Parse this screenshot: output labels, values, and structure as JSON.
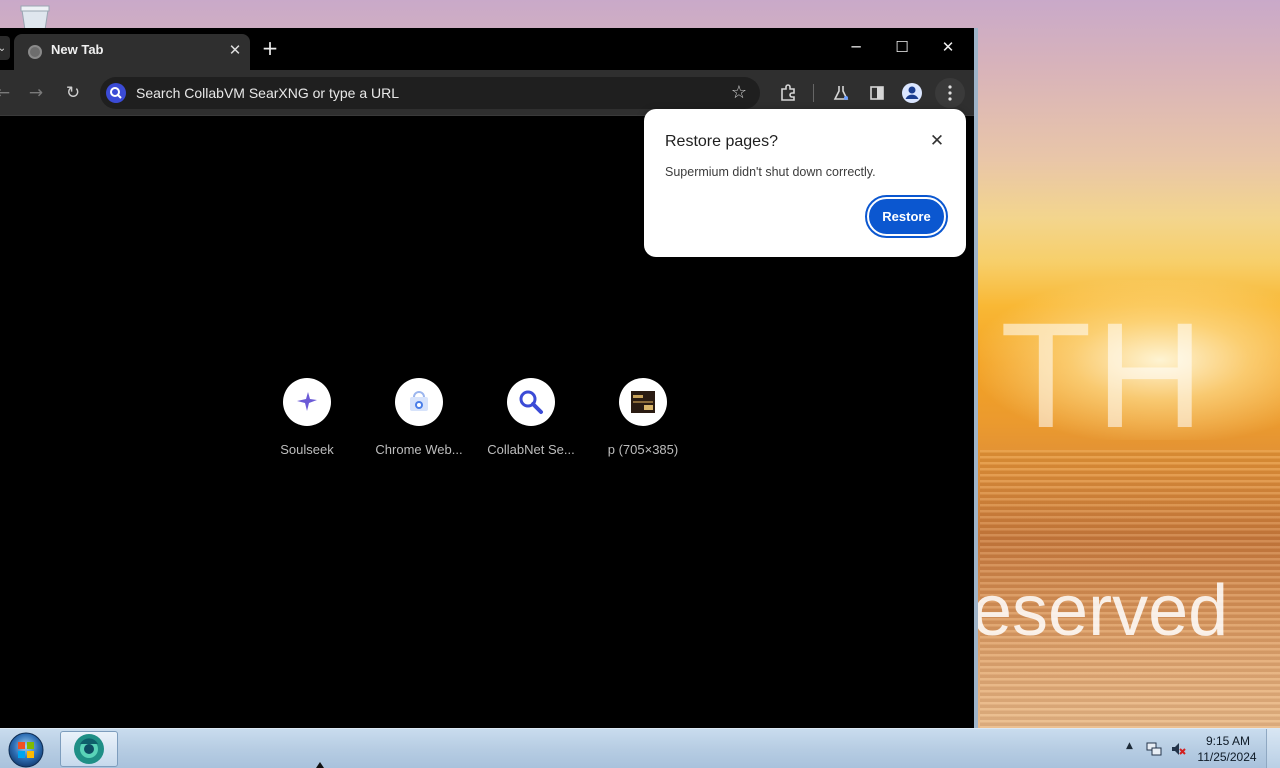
{
  "browser": {
    "tab": {
      "title": "New Tab",
      "favicon": "globe-icon"
    },
    "window_controls": {
      "minimize": "─",
      "maximize": "☐",
      "close": "✕"
    },
    "omnibox": {
      "placeholder": "Search CollabVM SearXNG or type a URL",
      "search_engine_icon": "search-icon"
    },
    "toolbar_icons": [
      "back-icon",
      "forward-icon",
      "reload-icon",
      "bookmark-star-icon",
      "extensions-icon",
      "labs-flask-icon",
      "side-panel-icon",
      "profile-icon",
      "menu-icon"
    ]
  },
  "shortcuts": [
    {
      "label": "Soulseek",
      "icon": "soulseek-bird-icon"
    },
    {
      "label": "Chrome Web...",
      "icon": "chrome-web-store-icon"
    },
    {
      "label": "CollabNet Se...",
      "icon": "search-magnifier-icon"
    },
    {
      "label": "p (705×385)",
      "icon": "image-thumbnail-icon"
    }
  ],
  "popup": {
    "title": "Restore pages?",
    "message": "Supermium didn't shut down correctly.",
    "restore_label": "Restore"
  },
  "wallpaper": {
    "text_top": "TH",
    "text_bottom": "eserved"
  },
  "taskbar": {
    "time": "9:15 AM",
    "date": "11/25/2024",
    "tray_icons": [
      "show-hidden-icons",
      "network-icon",
      "volume-muted-icon"
    ]
  },
  "colors": {
    "accent": "#0b57d0",
    "browser_frame": "#000000",
    "toolbar": "#2f2f2f"
  }
}
